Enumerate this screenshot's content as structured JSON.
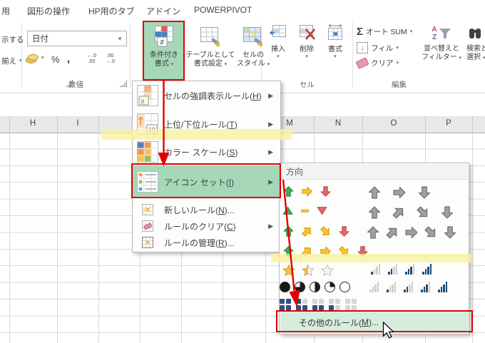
{
  "tabs": [
    "用",
    "図形の操作",
    "HP用のタブ",
    "アドイン",
    "POWERPIVOT"
  ],
  "ribbon": {
    "display_partial": "示する",
    "align_partial": "揃え",
    "number_format_value": "日付",
    "percent_label": "%",
    "comma_label": ",",
    "increase_decimal": {
      "top": "←.0",
      "bottom": ".00"
    },
    "decrease_decimal": {
      "top": ".00",
      "bottom": "→.0"
    },
    "number_group_label": "数値",
    "conditional_formatting": {
      "line1": "条件付き",
      "line2": "書式"
    },
    "conditional_icon_badge": "≠",
    "format_as_table": {
      "line1": "テーブルとして",
      "line2": "書式設定"
    },
    "cell_styles": {
      "line1": "セルの",
      "line2": "スタイル"
    },
    "insert_label": "挿入",
    "delete_label": "削除",
    "format_label": "書式",
    "cells_group_label": "セル",
    "sigma": "Σ",
    "autosum_label": "オート SUM",
    "fill_label": "フィル",
    "clear_label": "クリア",
    "sort_filter": {
      "line1": "並べ替えと",
      "line2": "フィルター"
    },
    "find_select": {
      "line1": "検索と",
      "line2": "選択"
    },
    "editing_group_label": "編集"
  },
  "sheet": {
    "column_headers": [
      "H",
      "I",
      "M",
      "N",
      "O",
      "P"
    ]
  },
  "menu": {
    "items": [
      {
        "text": "セルの強調表示ルール",
        "key": "H",
        "suffix": "",
        "icon": "highlight-cells-rules-icon",
        "submenu": true,
        "size": "large",
        "highlighted": false
      },
      {
        "text": "上位/下位ルール",
        "key": "T",
        "suffix": "",
        "icon": "top-bottom-rules-icon",
        "submenu": true,
        "size": "large",
        "highlighted": false
      },
      {
        "text": "カラー スケール",
        "key": "S",
        "suffix": "",
        "icon": "color-scales-icon",
        "submenu": true,
        "size": "large",
        "highlighted": false
      },
      {
        "text": "アイコン セット",
        "key": "I",
        "suffix": "",
        "icon": "icon-sets-icon",
        "submenu": true,
        "size": "large",
        "highlighted": true
      },
      {
        "text": "新しいルール",
        "key": "N",
        "suffix": "...",
        "icon": "new-rule-icon",
        "submenu": false,
        "size": "small",
        "highlighted": false
      },
      {
        "text": "ルールのクリア",
        "key": "C",
        "suffix": "",
        "icon": "clear-rules-icon",
        "submenu": true,
        "size": "small",
        "highlighted": false
      },
      {
        "text": "ルールの管理",
        "key": "R",
        "suffix": "...",
        "icon": "manage-rules-icon",
        "submenu": false,
        "size": "small",
        "highlighted": false
      }
    ]
  },
  "gallery": {
    "section_header": "方向",
    "rows": [
      {
        "left": [
          "arrow:up:green",
          "arrow:right:yellow",
          "arrow:down:red"
        ],
        "right": [
          "arrow:up:gray",
          "arrow:right:gray",
          "arrow:down:gray"
        ]
      },
      {
        "left": [
          "tri:up:green",
          "dash:yellow",
          "tri:down:red"
        ],
        "right": [
          "arrow:up:gray",
          "arrow:ne:gray",
          "arrow:se:gray",
          "arrow:down:gray"
        ]
      },
      {
        "left": [
          "arrow:up:green",
          "arrow:ne:yellow",
          "arrow:se:yellow",
          "arrow:down:red"
        ],
        "right": [
          "arrow:up:gray",
          "arrow:ne:gray",
          "arrow:right:gray",
          "arrow:se:gray",
          "arrow:down:gray"
        ]
      },
      {
        "left": [
          "arrow:up:green",
          "arrow:ne:yellow",
          "arrow:right:yellow",
          "arrow:se:yellow",
          "arrow:down:red"
        ],
        "right": []
      },
      {
        "left": [
          "star:full",
          "star:half",
          "star:empty"
        ],
        "right": [
          "bars:1",
          "bars:2",
          "bars:3",
          "bars:4"
        ]
      },
      {
        "left": [
          "circle:4",
          "circle:3",
          "circle:2",
          "circle:1",
          "circle:0"
        ],
        "right": [
          "bars:0",
          "bars:1",
          "bars:2",
          "bars:3",
          "bars:4"
        ]
      },
      {
        "left": [
          "squares:4",
          "squares:3",
          "squares:2",
          "squares:1",
          "squares:0"
        ],
        "right": []
      }
    ],
    "more_rules": {
      "text": "その他のルール",
      "key": "M",
      "suffix": "..."
    }
  },
  "colors": {
    "annotation_red": "#e00000",
    "highlight_green": "#a6d7b8",
    "more_rules_green": "#d6ecdd",
    "band_yellow": "#f8f1a0",
    "bars_navy": "#1f4e78",
    "bars_gray": "#d0cece",
    "squares_navy": "#2a5380",
    "squares_gray": "#d6d6d6"
  }
}
